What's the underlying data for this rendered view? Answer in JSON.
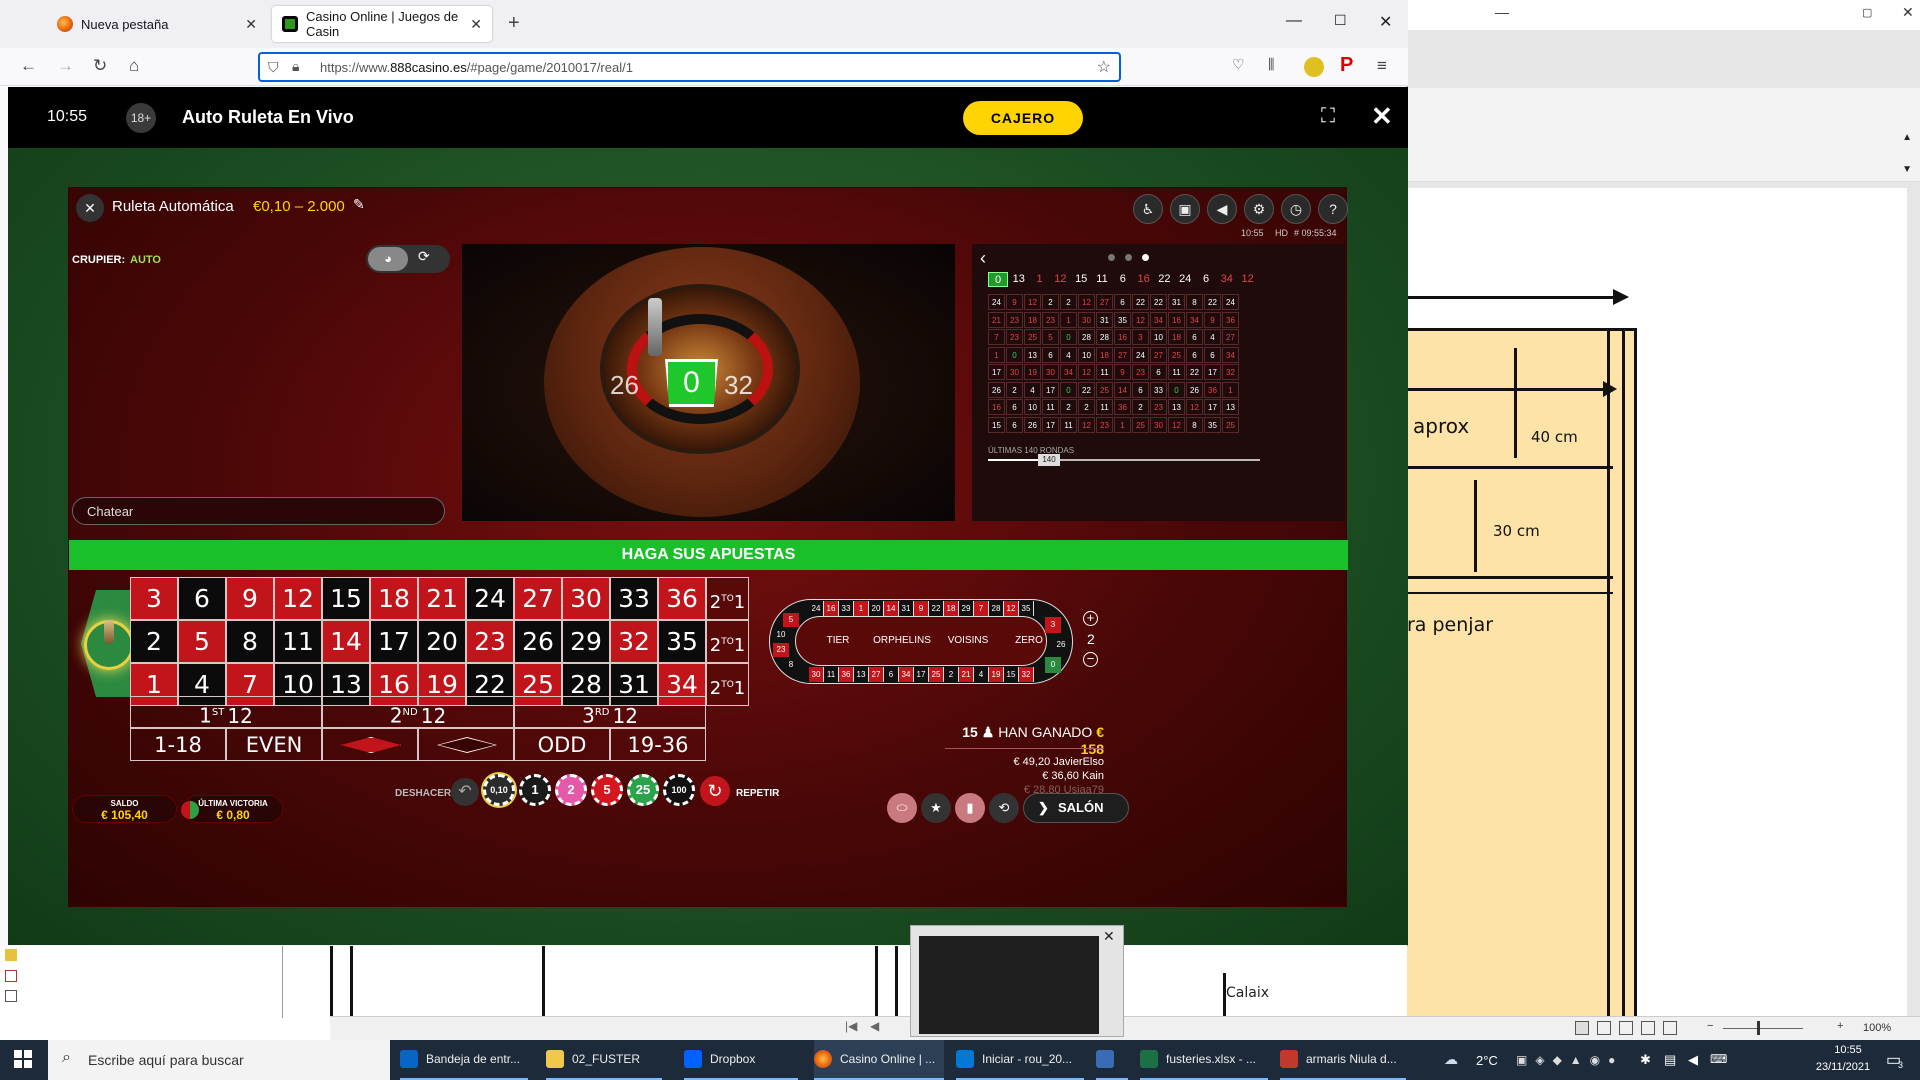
{
  "browser": {
    "tabs": [
      {
        "label": "Nueva pestaña",
        "active": false
      },
      {
        "label": "Casino Online | Juegos de Casin",
        "active": true
      }
    ],
    "url_prefix": "https://www.",
    "url_domain": "888casino.es",
    "url_path": "/#page/game/2010017/real/1"
  },
  "game_header": {
    "time": "10:55",
    "age": "18+",
    "title": "Auto Ruleta En Vivo",
    "cashier_label": "CAJERO"
  },
  "table": {
    "name": "Ruleta Automática",
    "limits": "€0,10 – 2.000",
    "dealer_label": "CRUPIER:",
    "dealer_value": "AUTO",
    "chat_placeholder": "Chatear",
    "clock_small": "10:55",
    "quality": "HD",
    "round_id": "# 09:55:34",
    "wheel_result": "0",
    "wheel_left": "26",
    "wheel_right": "32",
    "banner": "HAGA SUS APUESTAS"
  },
  "history": {
    "recent": [
      "0",
      "13",
      "1",
      "12",
      "15",
      "11",
      "6",
      "16",
      "22",
      "24",
      "6",
      "34",
      "12"
    ],
    "recent_colors": [
      "g",
      "b",
      "r",
      "r",
      "b",
      "b",
      "b",
      "r",
      "b",
      "b",
      "b",
      "r",
      "r"
    ],
    "grid": [
      [
        "24",
        "9",
        "12",
        "2",
        "2",
        "12",
        "27",
        "6",
        "22",
        "22",
        "31",
        "8",
        "22",
        "24"
      ],
      [
        "21",
        "23",
        "18",
        "23",
        "1",
        "30",
        "31",
        "35",
        "12",
        "34",
        "16",
        "34",
        "9",
        "36"
      ],
      [
        "7",
        "23",
        "25",
        "5",
        "0",
        "28",
        "28",
        "16",
        "3",
        "10",
        "18",
        "6",
        "4",
        "27"
      ],
      [
        "1",
        "0",
        "13",
        "6",
        "4",
        "10",
        "18",
        "27",
        "24",
        "27",
        "25",
        "6",
        "6",
        "34"
      ],
      [
        "17",
        "30",
        "19",
        "30",
        "34",
        "12",
        "11",
        "9",
        "23",
        "6",
        "11",
        "22",
        "17",
        "32"
      ],
      [
        "26",
        "2",
        "4",
        "17",
        "0",
        "22",
        "25",
        "14",
        "6",
        "33",
        "0",
        "26",
        "36",
        "1"
      ],
      [
        "16",
        "6",
        "10",
        "11",
        "2",
        "2",
        "11",
        "36",
        "2",
        "23",
        "13",
        "12",
        "17",
        "13"
      ],
      [
        "15",
        "6",
        "26",
        "17",
        "11",
        "12",
        "23",
        "1",
        "25",
        "30",
        "12",
        "8",
        "35",
        "25"
      ]
    ],
    "rounds_label": "ÚLTIMAS 140 RONDAS",
    "rounds_value": "140"
  },
  "board": {
    "rows": [
      [
        {
          "n": "3",
          "c": "r"
        },
        {
          "n": "6",
          "c": "b"
        },
        {
          "n": "9",
          "c": "r"
        },
        {
          "n": "12",
          "c": "r"
        },
        {
          "n": "15",
          "c": "b"
        },
        {
          "n": "18",
          "c": "r"
        },
        {
          "n": "21",
          "c": "r"
        },
        {
          "n": "24",
          "c": "b"
        },
        {
          "n": "27",
          "c": "r"
        },
        {
          "n": "30",
          "c": "r"
        },
        {
          "n": "33",
          "c": "b"
        },
        {
          "n": "36",
          "c": "r"
        }
      ],
      [
        {
          "n": "2",
          "c": "b"
        },
        {
          "n": "5",
          "c": "r"
        },
        {
          "n": "8",
          "c": "b"
        },
        {
          "n": "11",
          "c": "b"
        },
        {
          "n": "14",
          "c": "r"
        },
        {
          "n": "17",
          "c": "b"
        },
        {
          "n": "20",
          "c": "b"
        },
        {
          "n": "23",
          "c": "r"
        },
        {
          "n": "26",
          "c": "b"
        },
        {
          "n": "29",
          "c": "b"
        },
        {
          "n": "32",
          "c": "r"
        },
        {
          "n": "35",
          "c": "b"
        }
      ],
      [
        {
          "n": "1",
          "c": "r"
        },
        {
          "n": "4",
          "c": "b"
        },
        {
          "n": "7",
          "c": "r"
        },
        {
          "n": "10",
          "c": "b"
        },
        {
          "n": "13",
          "c": "b"
        },
        {
          "n": "16",
          "c": "r"
        },
        {
          "n": "19",
          "c": "r"
        },
        {
          "n": "22",
          "c": "b"
        },
        {
          "n": "25",
          "c": "r"
        },
        {
          "n": "28",
          "c": "b"
        },
        {
          "n": "31",
          "c": "b"
        },
        {
          "n": "34",
          "c": "r"
        }
      ]
    ],
    "column_bet_main": "2",
    "column_bet_sup": "TO",
    "column_bet_end": "1",
    "dozens": [
      {
        "num": "1",
        "sup": "ST",
        "end": "12"
      },
      {
        "num": "2",
        "sup": "ND",
        "end": "12"
      },
      {
        "num": "3",
        "sup": "RD",
        "end": "12"
      }
    ],
    "outside": [
      "1-18",
      "EVEN",
      "",
      "",
      "ODD",
      "19-36"
    ]
  },
  "racetrack": {
    "top": [
      "24",
      "16",
      "33",
      "1",
      "20",
      "14",
      "31",
      "9",
      "22",
      "18",
      "29",
      "7",
      "28",
      "12",
      "35"
    ],
    "top_colors": [
      "b",
      "r",
      "b",
      "r",
      "b",
      "r",
      "b",
      "r",
      "b",
      "r",
      "b",
      "r",
      "b",
      "r",
      "b"
    ],
    "bottom": [
      "30",
      "11",
      "36",
      "13",
      "27",
      "6",
      "34",
      "17",
      "25",
      "2",
      "21",
      "4",
      "19",
      "15",
      "32"
    ],
    "bottom_colors": [
      "r",
      "b",
      "r",
      "b",
      "r",
      "b",
      "r",
      "b",
      "r",
      "b",
      "r",
      "b",
      "r",
      "b",
      "r"
    ],
    "left": [
      "5",
      "10",
      "23",
      "8"
    ],
    "left_colors": [
      "r",
      "b",
      "r",
      "b"
    ],
    "right": [
      "3",
      "26",
      "0"
    ],
    "right_colors": [
      "r",
      "b",
      "g"
    ],
    "sections": [
      "TIER",
      "ORPHELINS",
      "VOISINS",
      "ZERO"
    ],
    "neighbours": "2"
  },
  "winners": {
    "count": "15",
    "label": "HAN GANADO",
    "amount": "€ 158",
    "list": [
      "€ 49,20 JavierElso",
      "€ 36,60 Kain",
      "€ 28,80 Usiaa79"
    ]
  },
  "controls": {
    "undo": "DESHACER",
    "repeat": "REPETIR",
    "chips": [
      "0,10",
      "1",
      "2",
      "5",
      "25",
      "100"
    ],
    "balance_label": "SALDO",
    "balance_value": "€ 105,40",
    "lastwin_label": "ÚLTIMA VICTORIA",
    "lastwin_value": "€ 0,80",
    "lobby": "SALÓN"
  },
  "doc": {
    "aprox": "aprox",
    "cm40": "40 cm",
    "cm30": "30 cm",
    "penjar": "ra penjar",
    "calaix": "Calaix",
    "zoom": "100%"
  },
  "taskbar": {
    "search": "Escribe aquí para buscar",
    "apps": [
      "Bandeja de entr...",
      "02_FUSTER",
      "Dropbox",
      "Casino Online | ...",
      "Iniciar - rou_20...",
      "",
      "fusteries.xlsx - ...",
      "armaris Niula d..."
    ],
    "temp": "2°C",
    "time": "10:55",
    "date": "23/11/2021",
    "notif": "3"
  }
}
